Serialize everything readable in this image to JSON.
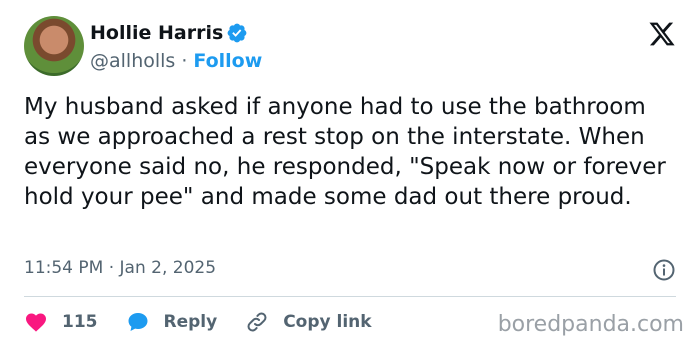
{
  "user": {
    "display_name": "Hollie Harris",
    "handle": "@allholls",
    "separator": "·",
    "follow_label": "Follow"
  },
  "tweet": {
    "text": "My husband asked if anyone had to use the bathroom as we approached a rest stop on the interstate. When everyone said no, he responded, \"Speak now or forever hold your pee\" and made some dad out there proud.",
    "timestamp": "11:54 PM · Jan 2, 2025"
  },
  "actions": {
    "like_count": "115",
    "reply_label": "Reply",
    "copy_label": "Copy link"
  },
  "watermark": "boredpanda.com",
  "colors": {
    "accent": "#1d9bf0",
    "like": "#f91880",
    "text": "#0f1419",
    "secondary": "#536471"
  }
}
